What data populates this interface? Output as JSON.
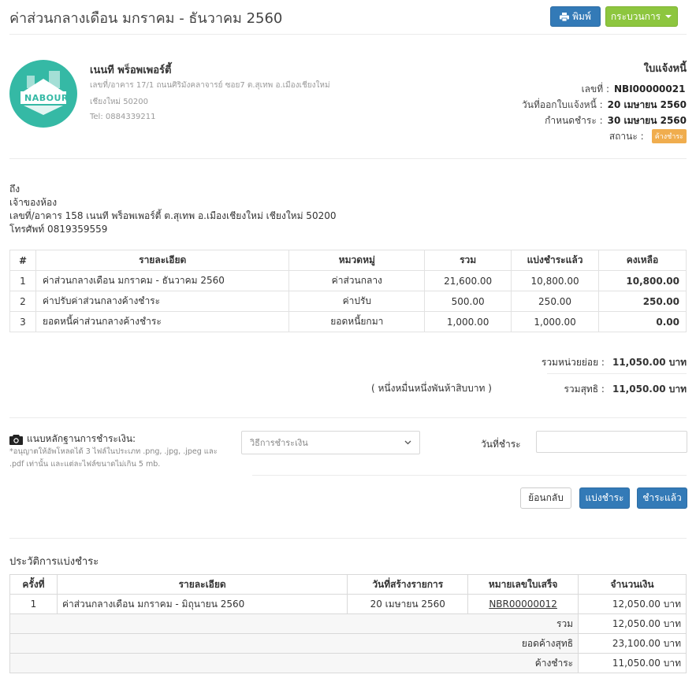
{
  "header": {
    "title": "ค่าส่วนกลางเดือน มกราคม - ธันวาคม 2560",
    "print_label": "พิมพ์",
    "process_label": "กระบวนการ"
  },
  "company": {
    "logo_text": "NABOUR",
    "name": "เนนที พร็อพเพอร์ตี้",
    "address_line1": "เลขที่/อาคาร 17/1 ถนนศิริมังคลาจารย์ ซอย7 ต.สุเทพ อ.เมืองเชียงใหม่",
    "address_line2": "เชียงใหม่ 50200",
    "tel": "Tel: 0884339211"
  },
  "invoice": {
    "heading": "ใบแจ้งหนี้",
    "number_label": "เลขที่ :",
    "number": "NBI00000021",
    "issue_label": "วันที่ออกใบแจ้งหนี้ :",
    "issue_date": "20 เมษายน 2560",
    "due_label": "กำหนดชำระ :",
    "due_date": "30 เมษายน 2560",
    "status_label": "สถานะ :",
    "status": "ค้างชำระ"
  },
  "recipient": {
    "to_label": "ถึง",
    "name": "เจ้าของห้อง",
    "address": "เลขที่/อาคาร 158 เนนที พร็อพเพอร์ตี้ ต.สุเทพ อ.เมืองเชียงใหม่ เชียงใหม่ 50200",
    "phone": "โทรศัพท์ 0819359559"
  },
  "items_table": {
    "headers": [
      "#",
      "รายละเอียด",
      "หมวดหมู่",
      "รวม",
      "แบ่งชำระแล้ว",
      "คงเหลือ"
    ],
    "rows": [
      [
        "1",
        "ค่าส่วนกลางเดือน มกราคม - ธันวาคม 2560",
        "ค่าส่วนกลาง",
        "21,600.00",
        "10,800.00",
        "10,800.00"
      ],
      [
        "2",
        "ค่าปรับค่าส่วนกลางค้างชำระ",
        "ค่าปรับ",
        "500.00",
        "250.00",
        "250.00"
      ],
      [
        "3",
        "ยอดหนี้ค่าส่วนกลางค้างชำระ",
        "ยอดหนี้ยกมา",
        "1,000.00",
        "1,000.00",
        "0.00"
      ]
    ]
  },
  "totals": {
    "subtotal_label": "รวมหน่วยย่อย :",
    "subtotal": "11,050.00 บาท",
    "amount_words": "( หนึ่งหมื่นหนึ่งพันห้าสิบบาท )",
    "net_label": "รวมสุทธิ :",
    "net": "11,050.00 บาท"
  },
  "payment": {
    "upload_label": "แนบหลักฐานการชำระเงิน:",
    "upload_note": "*อนุญาตให้อัพโหลดได้ 3 ไฟล์ในประเภท .png, .jpg, .jpeg และ .pdf เท่านั้น และแต่ละไฟล์ขนาดไม่เกิน 5 mb.",
    "method_placeholder": "วิธีการชำระเงิน",
    "date_label": "วันที่ชำระ",
    "back_label": "ย้อนกลับ",
    "split_label": "แบ่งชำระ",
    "paid_label": "ชำระแล้ว"
  },
  "history": {
    "title": "ประวัติการแบ่งชำระ",
    "headers": [
      "ครั้งที่",
      "รายละเอียด",
      "วันที่สร้างรายการ",
      "หมายเลขใบเสร็จ",
      "จำนวนเงิน"
    ],
    "rows": [
      [
        "1",
        "ค่าส่วนกลางเดือน มกราคม - มิถุนายน 2560",
        "20 เมษายน 2560",
        "NBR00000012",
        "12,050.00 บาท"
      ]
    ],
    "sum_label": "รวม",
    "sum_value": "12,050.00 บาท",
    "net_balance_label": "ยอดค้างสุทธิ",
    "net_balance_value": "23,100.00 บาท",
    "outstanding_label": "ค้างชำระ",
    "outstanding_value": "11,050.00 บาท"
  }
}
